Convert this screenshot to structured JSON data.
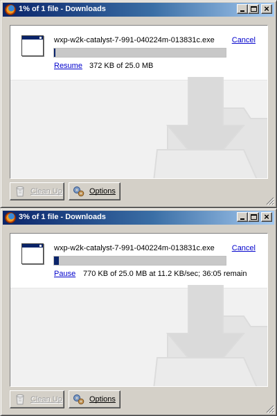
{
  "windows": [
    {
      "title": "1% of 1 file - Downloads",
      "item": {
        "filename": "wxp-w2k-catalyst-7-991-040224m-013831c.exe",
        "cancel_label": "Cancel",
        "action_label": "Resume",
        "status": "372 KB of 25.0 MB",
        "progress_fraction": 0.01
      },
      "buttons": {
        "cleanup_label": "Clean Up",
        "options_label": "Options"
      }
    },
    {
      "title": "3% of 1 file - Downloads",
      "item": {
        "filename": "wxp-w2k-catalyst-7-991-040224m-013831c.exe",
        "cancel_label": "Cancel",
        "action_label": "Pause",
        "status": "770 KB of 25.0 MB at 11.2 KB/sec; 36:05 remain",
        "progress_fraction": 0.03
      },
      "buttons": {
        "cleanup_label": "Clean Up",
        "options_label": "Options"
      }
    }
  ],
  "icons": {
    "title": "firefox-logo-icon",
    "file": "application-window-icon",
    "cleanup": "recycle-bin-icon",
    "options": "gears-icon",
    "watermark": "download-arrow-icon",
    "grip": "resize-grip-icon"
  },
  "colors": {
    "titlebar_start": "#0a246a",
    "titlebar_end": "#a6caf0",
    "progress_fill": "#0a246a",
    "link": "#0000cc",
    "window_face": "#d4d0c8"
  }
}
